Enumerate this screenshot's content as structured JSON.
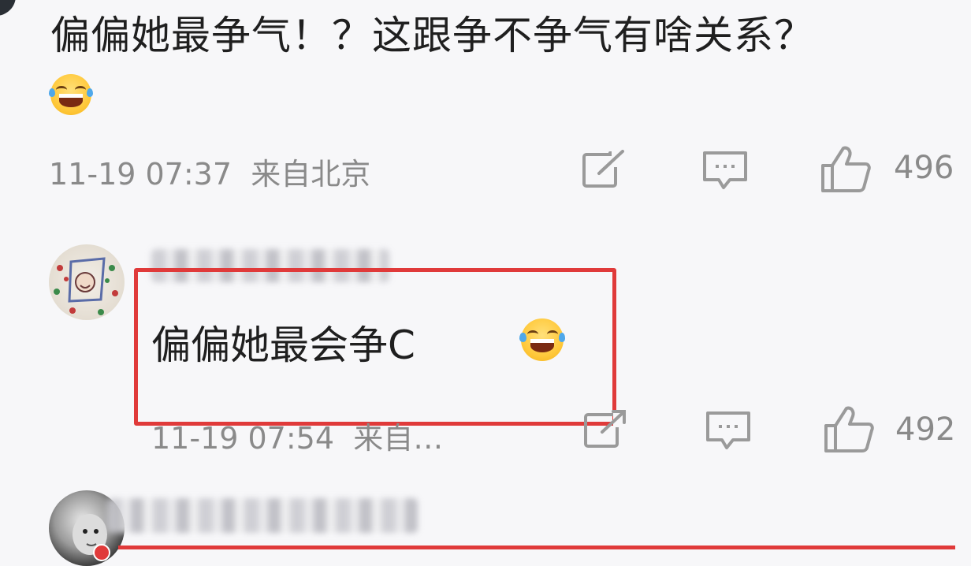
{
  "top_comment": {
    "text": "偏偏她最争气！？这跟争不争气有啥关系？",
    "emoji": "laughing-tears-emoji",
    "timestamp": "11-19 07:37",
    "location": "来自北京",
    "like_count": "496"
  },
  "reply_1": {
    "username_blurred": "",
    "text": "偏偏她最会争C",
    "emoji": "laughing-tears-emoji",
    "timestamp": "11-19 07:54",
    "location": "来自…",
    "like_count": "492",
    "highlight_color": "#e03a3a"
  },
  "reply_2": {
    "username_blurred": ""
  },
  "icons": {
    "share": "share-icon",
    "comment": "comment-icon",
    "like": "thumbs-up-icon"
  }
}
